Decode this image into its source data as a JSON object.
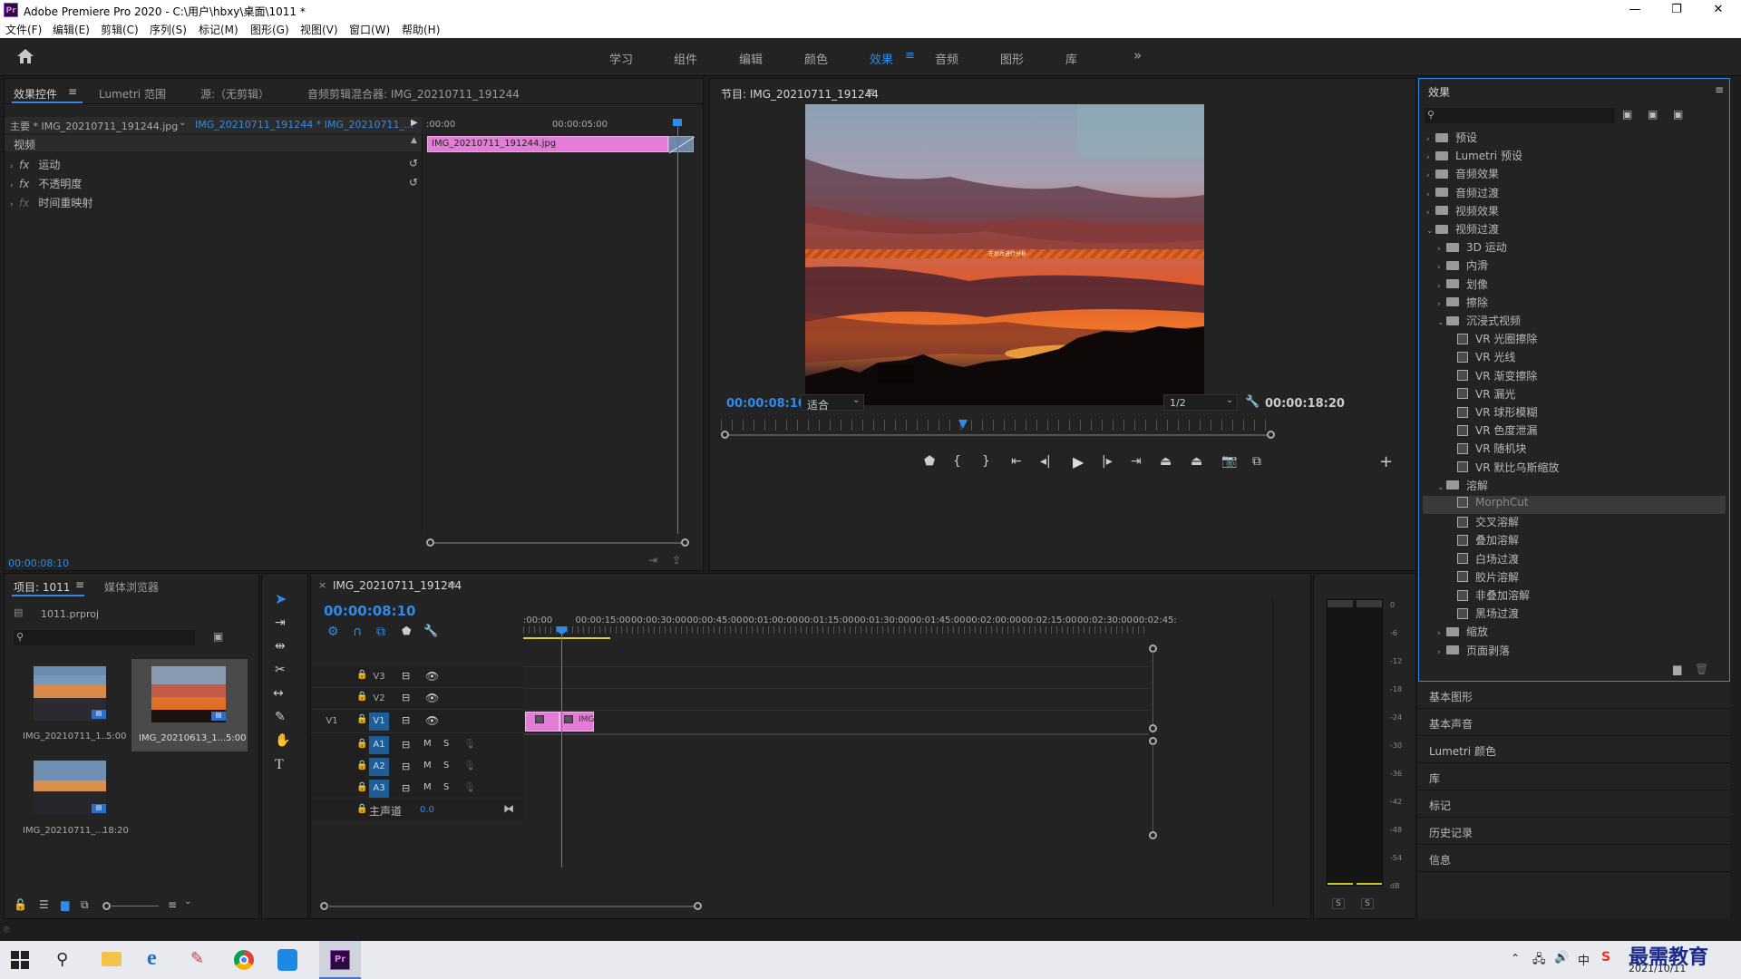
{
  "window": {
    "app_logo": "Pr",
    "title": "Adobe Premiere Pro 2020 - C:\\用户\\hbxy\\桌面\\1011 *",
    "controls": [
      "—",
      "❐",
      "✕"
    ]
  },
  "menu": [
    "文件(F)",
    "编辑(E)",
    "剪辑(C)",
    "序列(S)",
    "标记(M)",
    "图形(G)",
    "视图(V)",
    "窗口(W)",
    "帮助(H)"
  ],
  "workspaces": {
    "tabs": [
      "学习",
      "组件",
      "编辑",
      "颜色",
      "效果",
      "音频",
      "图形",
      "库"
    ],
    "active": "效果",
    "more": "»"
  },
  "effect_controls": {
    "tabs": [
      "效果控件",
      "Lumetri 范围",
      "源:（无剪辑）",
      "音频剪辑混合器: IMG_20210711_191244"
    ],
    "master_label": "主要 * IMG_20210711_191244.jpg",
    "sequence_label": "IMG_20210711_191244 * IMG_20210711_...",
    "ruler": [
      ":00:00",
      "00:00:05:00"
    ],
    "section_label": "视频",
    "clip_name": "IMG_20210711_191244.jpg",
    "effects": [
      {
        "fx": "fx",
        "name": "运动"
      },
      {
        "fx": "fx",
        "name": "不透明度"
      },
      {
        "fx": "fx",
        "name": "时间重映射"
      }
    ],
    "timecode": "00:00:08:10"
  },
  "program_monitor": {
    "title": "节目: IMG_20210711_191244",
    "overlay_text": "在后台进行分析",
    "timecode": "00:00:08:10",
    "fit": "适合",
    "quality": "1/2",
    "duration": "00:00:18:20"
  },
  "effects_panel": {
    "title": "效果",
    "search_placeholder": "",
    "tree": [
      {
        "level": 0,
        "arrow": "›",
        "type": "folder",
        "label": "预设"
      },
      {
        "level": 0,
        "arrow": "›",
        "type": "folder",
        "label": "Lumetri 预设"
      },
      {
        "level": 0,
        "arrow": "›",
        "type": "folder",
        "label": "音频效果"
      },
      {
        "level": 0,
        "arrow": "›",
        "type": "folder",
        "label": "音频过渡"
      },
      {
        "level": 0,
        "arrow": "›",
        "type": "folder",
        "label": "视频效果"
      },
      {
        "level": 0,
        "arrow": "⌄",
        "type": "folder",
        "label": "视频过渡"
      },
      {
        "level": 1,
        "arrow": "›",
        "type": "folder",
        "label": "3D 运动"
      },
      {
        "level": 1,
        "arrow": "›",
        "type": "folder",
        "label": "内滑"
      },
      {
        "level": 1,
        "arrow": "›",
        "type": "folder",
        "label": "划像"
      },
      {
        "level": 1,
        "arrow": "›",
        "type": "folder",
        "label": "擦除"
      },
      {
        "level": 1,
        "arrow": "⌄",
        "type": "folder",
        "label": "沉浸式视频"
      },
      {
        "level": 2,
        "arrow": "",
        "type": "fx",
        "label": "VR 光圈擦除"
      },
      {
        "level": 2,
        "arrow": "",
        "type": "fx",
        "label": "VR 光线"
      },
      {
        "level": 2,
        "arrow": "",
        "type": "fx",
        "label": "VR 渐变擦除"
      },
      {
        "level": 2,
        "arrow": "",
        "type": "fx",
        "label": "VR 漏光"
      },
      {
        "level": 2,
        "arrow": "",
        "type": "fx",
        "label": "VR 球形模糊"
      },
      {
        "level": 2,
        "arrow": "",
        "type": "fx",
        "label": "VR 色度泄漏"
      },
      {
        "level": 2,
        "arrow": "",
        "type": "fx",
        "label": "VR 随机块"
      },
      {
        "level": 2,
        "arrow": "",
        "type": "fx",
        "label": "VR 默比乌斯缩放"
      },
      {
        "level": 1,
        "arrow": "⌄",
        "type": "folder",
        "label": "溶解"
      },
      {
        "level": 2,
        "arrow": "",
        "type": "fx",
        "label": "MorphCut",
        "selected": true
      },
      {
        "level": 2,
        "arrow": "",
        "type": "fx",
        "label": "交叉溶解"
      },
      {
        "level": 2,
        "arrow": "",
        "type": "fx",
        "label": "叠加溶解"
      },
      {
        "level": 2,
        "arrow": "",
        "type": "fx",
        "label": "白场过渡"
      },
      {
        "level": 2,
        "arrow": "",
        "type": "fx",
        "label": "胶片溶解"
      },
      {
        "level": 2,
        "arrow": "",
        "type": "fx",
        "label": "非叠加溶解"
      },
      {
        "level": 2,
        "arrow": "",
        "type": "fx",
        "label": "黑场过渡"
      },
      {
        "level": 1,
        "arrow": "›",
        "type": "folder",
        "label": "缩放"
      },
      {
        "level": 1,
        "arrow": "›",
        "type": "folder",
        "label": "页面剥落"
      }
    ]
  },
  "side_panels": [
    "基本图形",
    "基本声音",
    "Lumetri 颜色",
    "库",
    "标记",
    "历史记录",
    "信息"
  ],
  "project": {
    "tabs": [
      "项目: 1011",
      "媒体浏览器"
    ],
    "file": "1011.prproj",
    "items": [
      {
        "name": "IMG_20210711_1...",
        "duration": "5:00"
      },
      {
        "name": "IMG_20210613_1...",
        "duration": "5:00"
      },
      {
        "name": "IMG_20210711_...",
        "duration": "18:20"
      }
    ]
  },
  "timeline": {
    "tab": "IMG_20210711_191244",
    "timecode": "00:00:08:10",
    "ruler": [
      ":00:00",
      "00:00:15:00",
      "00:00:30:00",
      "00:00:45:00",
      "00:01:00:00",
      "00:01:15:00",
      "00:01:30:00",
      "00:01:45:00",
      "00:02:00:00",
      "00:02:15:00",
      "00:02:30:00",
      "00:02:45:"
    ],
    "video_tracks": [
      "V3",
      "V2",
      "V1"
    ],
    "source_patch": "V1",
    "audio_tracks": [
      "A1",
      "A2",
      "A3"
    ],
    "master_label": "主声道",
    "master_value": "0.0",
    "clip_label": "IMG",
    "track_m": "M",
    "track_s": "S"
  },
  "meter": {
    "scale": [
      "0",
      "-6",
      "-12",
      "-18",
      "-24",
      "-30",
      "-36",
      "-42",
      "-48",
      "-54",
      "dB"
    ],
    "solo": [
      "S",
      "S"
    ]
  },
  "taskbar": {
    "date": "2021/10/11",
    "ime": "中",
    "watermark": "最需教育"
  },
  "colors": {
    "accent": "#2d8ceb",
    "clip_pink": "#e37cd6",
    "panel_bg": "#232323",
    "selected_row": "#3a3a3a"
  }
}
